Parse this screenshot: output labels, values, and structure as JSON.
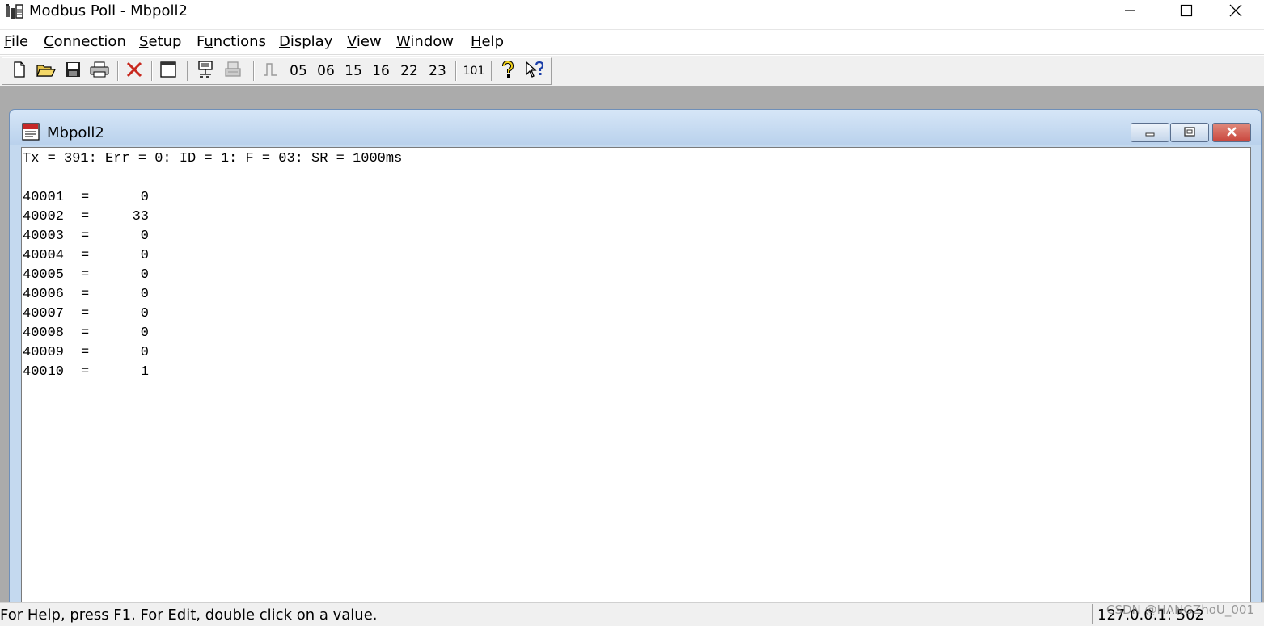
{
  "app": {
    "title": "Modbus Poll - Mbpoll2"
  },
  "menu": [
    {
      "label": "File",
      "accel": "F",
      "rest": "ile"
    },
    {
      "label": "Connection",
      "accel": "C",
      "rest": "onnection"
    },
    {
      "label": "Setup",
      "accel": "S",
      "rest": "etup"
    },
    {
      "label": "Functions",
      "accel": "u",
      "pre": "F",
      "rest": "nctions"
    },
    {
      "label": "Display",
      "accel": "D",
      "rest": "isplay"
    },
    {
      "label": "View",
      "accel": "V",
      "rest": "iew"
    },
    {
      "label": "Window",
      "accel": "W",
      "rest": "indow"
    },
    {
      "label": "Help",
      "accel": "H",
      "rest": "elp"
    }
  ],
  "toolbar": {
    "function_codes": [
      "05",
      "06",
      "15",
      "16",
      "22",
      "23"
    ],
    "stats_label": "101",
    "icons": [
      "new-icon",
      "open-icon",
      "save-icon",
      "print-icon",
      "delete-icon",
      "window-icon",
      "connect-icon",
      "disconnect-icon",
      "pulse-icon",
      "about-icon",
      "context-help-icon"
    ]
  },
  "child_window": {
    "title": "Mbpoll2",
    "status_line": "Tx = 391: Err = 0: ID = 1: F = 03: SR = 1000ms",
    "registers": [
      {
        "address": "40001",
        "value": "0"
      },
      {
        "address": "40002",
        "value": "33"
      },
      {
        "address": "40003",
        "value": "0"
      },
      {
        "address": "40004",
        "value": "0"
      },
      {
        "address": "40005",
        "value": "0"
      },
      {
        "address": "40006",
        "value": "0"
      },
      {
        "address": "40007",
        "value": "0"
      },
      {
        "address": "40008",
        "value": "0"
      },
      {
        "address": "40009",
        "value": "0"
      },
      {
        "address": "40010",
        "value": "1"
      }
    ]
  },
  "statusbar": {
    "help_text": "For Help, press F1.  For Edit, double click on a value.",
    "connection": "127.0.0.1: 502"
  },
  "watermark": "CSDN @HANGZhoU_001",
  "colors": {
    "mdi_background": "#ababab",
    "child_caption": "#c4d9ef",
    "close_button": "#c9463d"
  }
}
